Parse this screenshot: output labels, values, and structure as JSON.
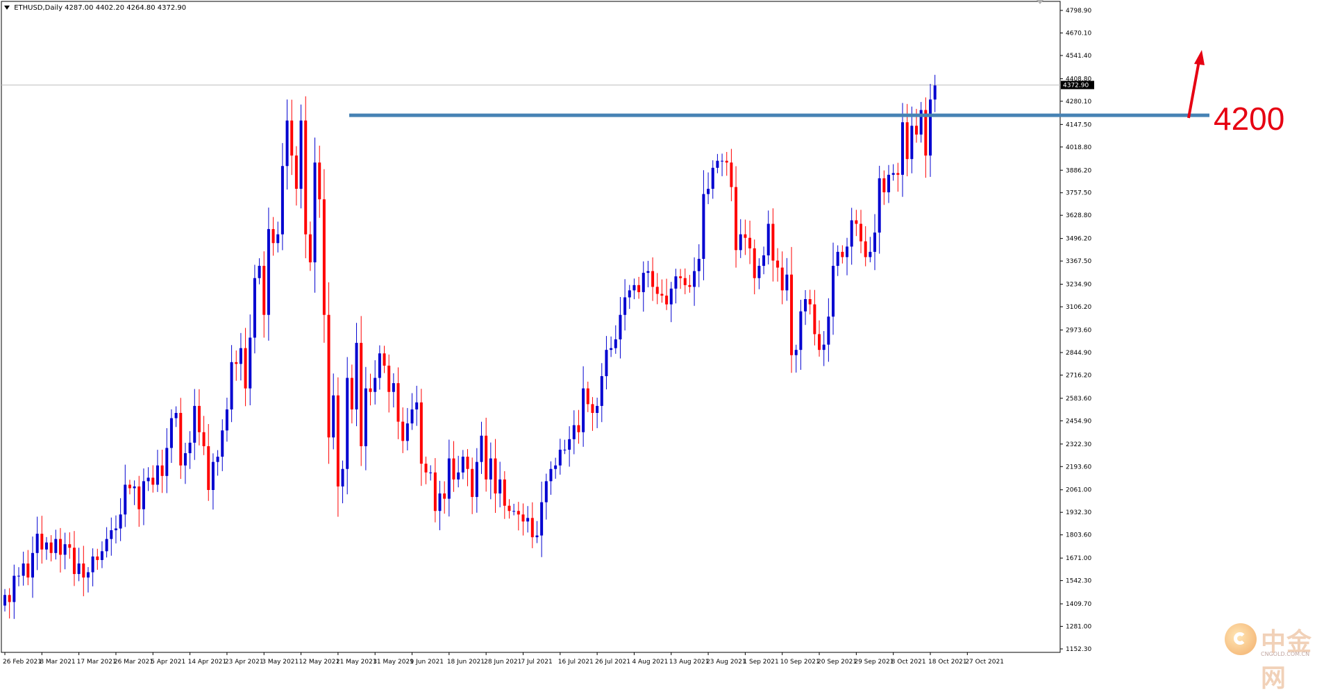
{
  "header": {
    "symbol": "ETHUSD,Daily",
    "ohlc": "4287.00 4402.20 4264.80 4372.90"
  },
  "annotation": {
    "level_text": "4200",
    "level_value": 4200,
    "level_color": "#4682b4",
    "arrow_color": "#e60012"
  },
  "watermark": {
    "brand_text": "中金网",
    "domain_text": "CNGOLD.COM.CN"
  },
  "colors": {
    "bull": "#0000d0",
    "bear": "#ff0000",
    "axis": "#000000",
    "price_line": "#c0c0c0"
  },
  "chart_data": {
    "type": "candlestick",
    "symbol": "ETHUSD",
    "timeframe": "Daily",
    "y_ticks": [
      "4798.90",
      "4670.10",
      "4541.40",
      "4408.80",
      "4280.10",
      "4147.50",
      "4018.80",
      "3886.20",
      "3757.50",
      "3628.80",
      "3496.20",
      "3367.50",
      "3234.90",
      "3106.20",
      "2973.60",
      "2844.90",
      "2716.20",
      "2583.60",
      "2454.90",
      "2322.30",
      "2193.60",
      "2061.00",
      "1932.30",
      "1803.60",
      "1671.00",
      "1542.30",
      "1409.70",
      "1281.00",
      "1152.30"
    ],
    "ylim": [
      1152.3,
      4798.9
    ],
    "last_price": 4372.9,
    "last_price_label": "4372.90",
    "x_labels": [
      "26 Feb 2021",
      "8 Mar 2021",
      "17 Mar 2021",
      "26 Mar 2021",
      "5 Apr 2021",
      "14 Apr 2021",
      "23 Apr 2021",
      "3 May 2021",
      "12 May 2021",
      "21 May 2021",
      "31 May 2021",
      "9 Jun 2021",
      "18 Jun 2021",
      "28 Jun 2021",
      "7 Jul 2021",
      "16 Jul 2021",
      "26 Jul 2021",
      "4 Aug 2021",
      "13 Aug 2021",
      "23 Aug 2021",
      "1 Sep 2021",
      "10 Sep 2021",
      "20 Sep 2021",
      "29 Sep 2021",
      "8 Oct 2021",
      "18 Oct 2021",
      "27 Oct 2021"
    ],
    "x_label_bar_index": [
      0,
      8,
      16,
      24,
      32,
      40,
      48,
      56,
      64,
      72,
      80,
      88,
      96,
      104,
      112,
      120,
      128,
      136,
      144,
      152,
      160,
      168,
      176,
      184,
      192,
      200,
      208
    ],
    "closes": [
      1460,
      1420,
      1570,
      1570,
      1640,
      1560,
      1700,
      1810,
      1720,
      1760,
      1700,
      1780,
      1690,
      1750,
      1730,
      1580,
      1640,
      1560,
      1590,
      1680,
      1660,
      1710,
      1780,
      1830,
      1840,
      1920,
      2090,
      2070,
      2080,
      1950,
      2110,
      2130,
      2090,
      2200,
      2140,
      2300,
      2470,
      2500,
      2200,
      2270,
      2330,
      2540,
      2390,
      2310,
      2060,
      2220,
      2250,
      2400,
      2520,
      2790,
      2780,
      2870,
      2640,
      2930,
      3270,
      3340,
      3060,
      3550,
      3470,
      3520,
      3910,
      4170,
      3970,
      3780,
      4170,
      3520,
      3360,
      3930,
      3720,
      3060,
      2360,
      2600,
      2080,
      2180,
      2700,
      2520,
      2900,
      2310,
      2640,
      2620,
      2700,
      2840,
      2770,
      2620,
      2670,
      2450,
      2340,
      2440,
      2520,
      2560,
      2210,
      2160,
      2160,
      1940,
      2040,
      2010,
      2240,
      2120,
      2160,
      2250,
      2180,
      2020,
      2220,
      2370,
      2120,
      2240,
      2040,
      2120,
      1970,
      1940,
      1940,
      1920,
      1880,
      1900,
      1790,
      1800,
      1990,
      2110,
      2180,
      2200,
      2290,
      2290,
      2350,
      2430,
      2390,
      2640,
      2550,
      2500,
      2540,
      2710,
      2860,
      2870,
      2920,
      3060,
      3160,
      3200,
      3230,
      3190,
      3300,
      3310,
      3220,
      3180,
      3170,
      3120,
      3210,
      3280,
      3270,
      3230,
      3220,
      3310,
      3380,
      3750,
      3780,
      3900,
      3940,
      3940,
      3930,
      3790,
      3430,
      3520,
      3500,
      3440,
      3270,
      3340,
      3400,
      3580,
      3370,
      3330,
      3200,
      3290,
      2830,
      2860,
      3080,
      3150,
      3120,
      2950,
      2860,
      2890,
      3050,
      3340,
      3420,
      3390,
      3450,
      3600,
      3580,
      3480,
      3390,
      3420,
      3530,
      3840,
      3760,
      3860,
      3870,
      3860,
      4160,
      3950,
      4140,
      4090,
      4230,
      3970,
      4290,
      4370
    ],
    "last_bar_index": 211
  }
}
